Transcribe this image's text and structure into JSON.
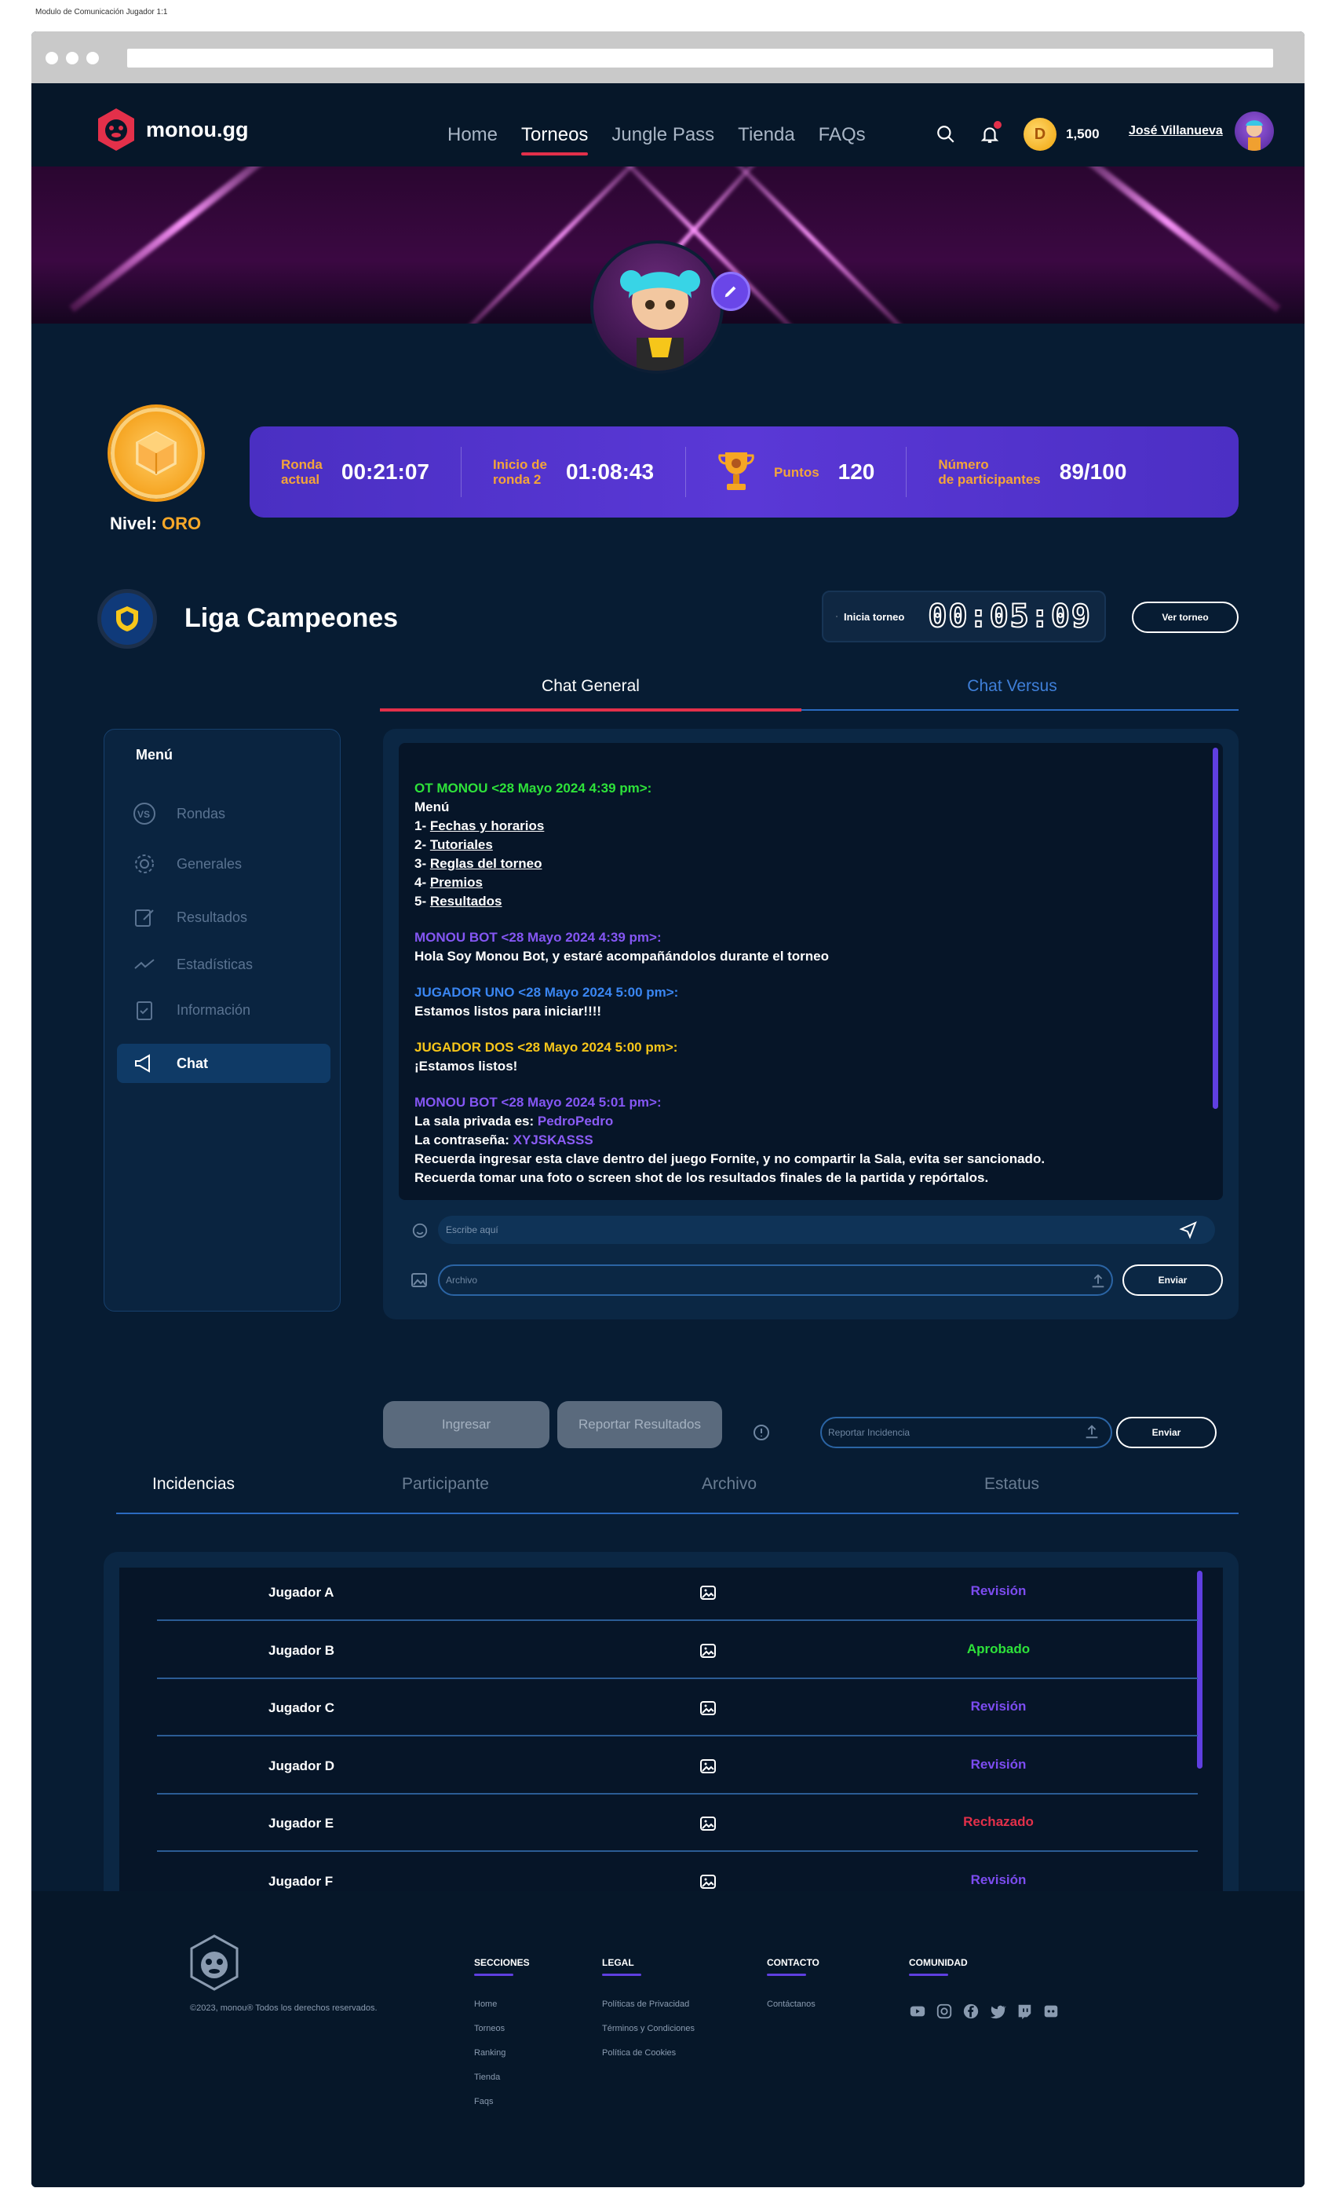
{
  "frame": {
    "caption": "Modulo de Comunicación Jugador 1:1"
  },
  "header": {
    "brand": "monou.gg",
    "nav": [
      "Home",
      "Torneos",
      "Jungle Pass",
      "Tienda",
      "FAQs"
    ],
    "coins": "1,500",
    "user_name": "José Villanueva"
  },
  "level": {
    "label": "Nivel:",
    "value": "ORO"
  },
  "stats": {
    "round_label_1": "Ronda",
    "round_label_2": "actual",
    "round_value": "00:21:07",
    "start_label_1": "Inicio de",
    "start_label_2": "ronda 2",
    "start_value": "01:08:43",
    "points_label": "Puntos",
    "points_value": "120",
    "participants_label_1": "Número",
    "participants_label_2": "de participantes",
    "participants_value": "89/100"
  },
  "league": {
    "title": "Liga Campeones",
    "timer_label": "Inicia torneo",
    "timer_value": "00:05:09",
    "view_button": "Ver torneo"
  },
  "tabs": {
    "general": "Chat General",
    "versus": "Chat Versus"
  },
  "sidebar": {
    "title": "Menú",
    "items": [
      "Rondas",
      "Generales",
      "Resultados",
      "Estadísticas",
      "Información",
      "Chat"
    ]
  },
  "chat": {
    "m1_header": "OT MONOU <28 Mayo 2024 4:39 pm>:",
    "m1_menu": "Menú",
    "m1_items": [
      {
        "num": "1- ",
        "text": "Fechas y horarios"
      },
      {
        "num": "2- ",
        "text": "Tutoriales"
      },
      {
        "num": "3- ",
        "text": "Reglas del torneo"
      },
      {
        "num": "4- ",
        "text": "Premios"
      },
      {
        "num": "5- ",
        "text": "Resultados"
      }
    ],
    "m2_header": "MONOU BOT <28 Mayo 2024 4:39 pm>:",
    "m2_text": "Hola Soy Monou Bot, y estaré acompañándolos durante el torneo",
    "m3_header": "JUGADOR UNO <28 Mayo 2024 5:00 pm>:",
    "m3_text": "Estamos listos para iniciar!!!!",
    "m4_header": "JUGADOR DOS <28 Mayo 2024 5:00 pm>:",
    "m4_text": "¡Estamos listos!",
    "m5_header": "MONOU BOT <28 Mayo 2024 5:01 pm>:",
    "m5_room_label": "La sala privada es: ",
    "m5_room_value": "PedroPedro",
    "m5_pass_label": "La contraseña: ",
    "m5_pass_value": "XYJSKASSS",
    "m5_line3": "Recuerda ingresar esta clave dentro del juego Fornite, y no compartir la Sala, evita ser sancionado.",
    "m5_line4": "Recuerda tomar una foto o screen shot de los resultados finales de la partida y repórtalos.",
    "input_placeholder": "Escribe aquí",
    "file_placeholder": "Archivo",
    "send_label": "Enviar"
  },
  "actions": {
    "enter": "Ingresar",
    "report": "Reportar Resultados",
    "incident_placeholder": "Reportar Incidencia",
    "send": "Enviar"
  },
  "incidents": {
    "columns": [
      "Incidencias",
      "Participante",
      "Archivo",
      "Estatus"
    ],
    "rows": [
      {
        "name": "Jugador A",
        "status": "Revisión",
        "color": "#7c4cf0"
      },
      {
        "name": "Jugador B",
        "status": "Aprobado",
        "color": "#2ee23a"
      },
      {
        "name": "Jugador C",
        "status": "Revisión",
        "color": "#7c4cf0"
      },
      {
        "name": "Jugador D",
        "status": "Revisión",
        "color": "#7c4cf0"
      },
      {
        "name": "Jugador E",
        "status": "Rechazado",
        "color": "#e3304a"
      },
      {
        "name": "Jugador F",
        "status": "Revisión",
        "color": "#7c4cf0"
      }
    ]
  },
  "footer": {
    "copyright": "©2023, monou® Todos los derechos reservados.",
    "sections_title": "SECCIONES",
    "sections": [
      "Home",
      "Torneos",
      "Ranking",
      "Tienda",
      "Faqs"
    ],
    "legal_title": "LEGAL",
    "legal": [
      "Políticas de Privacidad",
      "Términos y Condiciones",
      "Política de Cookies"
    ],
    "contact_title": "CONTACTO",
    "contact": [
      "Contáctanos"
    ],
    "community_title": "COMUNIDAD",
    "social_icons": [
      "youtube-icon",
      "instagram-icon",
      "facebook-icon",
      "twitter-icon",
      "twitch-icon",
      "discord-icon"
    ]
  },
  "colors": {
    "accent": "#e3304a",
    "purple": "#5f3fe0",
    "gold": "#f7a829",
    "bg": "#071c33"
  }
}
